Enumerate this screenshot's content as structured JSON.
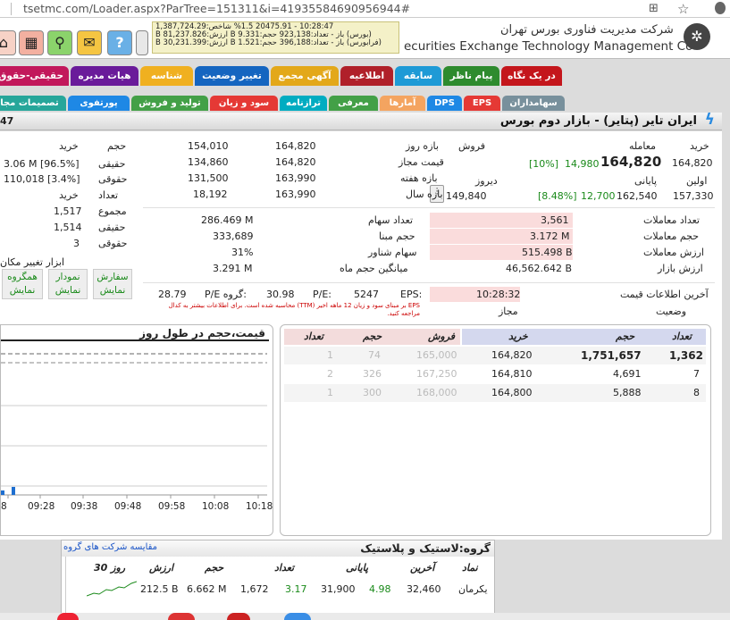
{
  "browser": {
    "url": "tsetmc.com/Loader.aspx?ParTree=151311&i=41935584690956944#"
  },
  "ticker": {
    "line1": "10:28:47 - 20475.91 %1.5 شاخص:1,387,724.29",
    "line2": "(بورس) باز - تعداد:923,138 حجم:9.331 B ارزش:81,237.826 B",
    "line3": "(فرابورس) باز - تعداد:396,188 حجم:1.521 B ارزش:30,231.399 B"
  },
  "company": {
    "name_fa": "شرکت مدیریت فناوری بورس تهران",
    "name_en": "ecurities Exchange Technology Management Co"
  },
  "tabs_row1": [
    {
      "label": "در یک نگاه",
      "color": "#c4161c"
    },
    {
      "label": "پیام ناظر",
      "color": "#2e8b2e"
    },
    {
      "label": "سابقه",
      "color": "#1e9ad6"
    },
    {
      "label": "اطلاعیه",
      "color": "#b0202a"
    },
    {
      "label": "آگهی مجمع",
      "color": "#e3a81a"
    },
    {
      "label": "تغییر وضعیت",
      "color": "#1565c0"
    },
    {
      "label": "شناسه",
      "color": "#f0b020"
    },
    {
      "label": "هیات مدیره",
      "color": "#6a1b9a"
    },
    {
      "label": "حقیقی-حقوق",
      "color": "#c2185b"
    }
  ],
  "tabs_row2": [
    {
      "label": "سهامداران",
      "color": "#78909c"
    },
    {
      "label": "EPS",
      "color": "#e53935"
    },
    {
      "label": "DPS",
      "color": "#1e88e5"
    },
    {
      "label": "آمارها",
      "color": "#f4a460"
    },
    {
      "label": "معرفی",
      "color": "#43a047"
    },
    {
      "label": "ترازنامه",
      "color": "#00acc1"
    },
    {
      "label": "سود و زیان",
      "color": "#e53935"
    },
    {
      "label": "تولید و فروش",
      "color": "#43a047"
    },
    {
      "label": "پورتفوی",
      "color": "#1e88e5"
    },
    {
      "label": "تصمیمات مجا",
      "color": "#26a69a"
    }
  ],
  "symbol": {
    "title": "ایران تایر (پتایر) - بازار دوم بورس",
    "left_code": "47"
  },
  "prices": {
    "buy_label": "خرید",
    "trade_label": "معامله",
    "sell_label": "فروش",
    "buy": "164,820",
    "trade": "164,820",
    "trade_pct": "[10%]",
    "trade_change": "14,980",
    "first_label": "اولین",
    "last_label": "پایانی",
    "yesterday_label": "دیروز",
    "first": "157,330",
    "last": "162,540",
    "last_change": "12,700",
    "last_pct": "[8.48%]",
    "yesterday": "149,840"
  },
  "ranges": {
    "labels": [
      "بازه روز",
      "قیمت مجاز",
      "بازه هفته",
      "بازه سال"
    ],
    "high": [
      "164,820",
      "164,820",
      "163,990",
      "163,990"
    ],
    "low": [
      "154,010",
      "134,860",
      "131,500",
      "18,192"
    ]
  },
  "client": {
    "headers": [
      "حجم",
      "خرید"
    ],
    "labels": [
      "حقیقی",
      "حقوقی",
      "تعداد",
      "مجموع",
      "حقیقی",
      "حقوقی"
    ],
    "values": [
      "3.06 M [96.5%]",
      "110,018 [3.4%]",
      "خرید",
      "1,517",
      "1,514",
      "3"
    ]
  },
  "stats": {
    "labels": [
      "تعداد معاملات",
      "حجم معاملات",
      "ارزش معاملات",
      "ارزش بازار"
    ],
    "values": [
      "3,561",
      "3.172 M",
      "515.498 B",
      "46,562.642 B"
    ],
    "labels2": [
      "تعداد سهام",
      "حجم مبنا",
      "سهام شناور",
      "میانگین حجم ماه"
    ],
    "values2": [
      "286.469 M",
      "333,689",
      "31%",
      "3.291 M"
    ]
  },
  "tools": {
    "title": "ابزار تغییر مکان",
    "items": [
      "سفارش نمایش",
      "نمودار نمایش",
      "همگروه نمایش"
    ]
  },
  "info": {
    "last_info_label": "آخرین اطلاعات قیمت",
    "last_info_value": "10:28:32",
    "status_label": "وضعیت",
    "status_value": "مجاز",
    "eps_label": "EPS:",
    "eps_value": "5247",
    "pe_label": "P/E:",
    "pe_value": "30.98",
    "gpe_label": "P/E گروه:",
    "gpe_value": "28.79",
    "note": "EPS بر مبنای سود و زیان 12 ماهه اخیر (TTM) محاسبه شده است. برای اطلاعات بیشتر به کدال مراجعه کنید."
  },
  "orders": {
    "headers": [
      "تعداد",
      "حجم",
      "خرید",
      "فروش",
      "حجم",
      "تعداد"
    ],
    "rows": [
      [
        "1,362",
        "1,751,657",
        "164,820",
        "165,000",
        "74",
        "1"
      ],
      [
        "7",
        "4,691",
        "164,810",
        "167,250",
        "326",
        "2"
      ],
      [
        "8",
        "5,888",
        "164,800",
        "168,000",
        "300",
        "1"
      ]
    ]
  },
  "chart": {
    "title": "قیمت،حجم در طول روز",
    "x_ticks": [
      "8",
      "09:28",
      "09:38",
      "09:48",
      "09:58",
      "10:08",
      "10:18"
    ]
  },
  "group": {
    "title": "گروه:لاستیک و پلاستیک",
    "compare_link": "مقایسه شرکت های گروه",
    "headers": [
      "نماد",
      "آخرین",
      "پایانی",
      "تعداد",
      "حجم",
      "ارزش",
      "30 روز"
    ],
    "rows": [
      [
        "یکرمان",
        "32,460",
        "4.98",
        "31,900",
        "3.17",
        "1,672",
        "6.662 M",
        "212.5 B"
      ]
    ]
  },
  "colors": {
    "green": "#1a8a1a",
    "red": "#cc0000",
    "pink": "#fadcdc",
    "blue_head": "#d4d8ee"
  }
}
